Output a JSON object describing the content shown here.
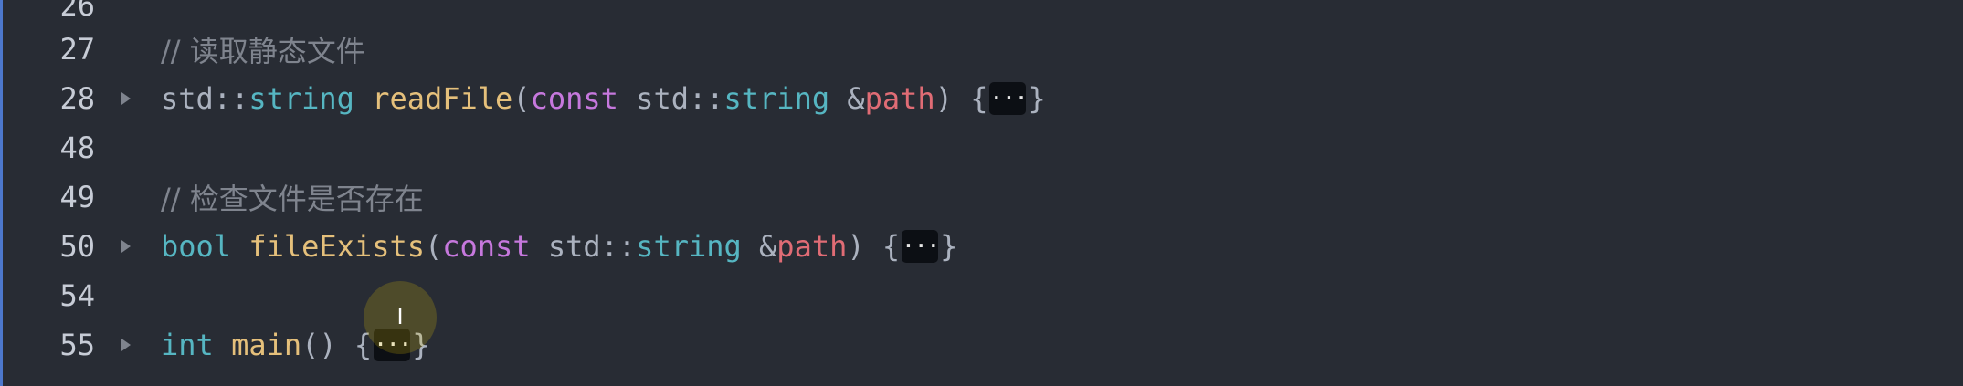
{
  "editor": {
    "lines": [
      {
        "number": "26"
      },
      {
        "number": "27",
        "comment": "// 读取静态文件"
      },
      {
        "number": "28",
        "tokens": {
          "ns": "std::",
          "type": "string",
          "fn": "readFile",
          "paren_open": "(",
          "kw": "const",
          "ns2": "std::",
          "type2": "string",
          "amp": "&",
          "param": "path",
          "paren_close": ")",
          "brace_open": "{",
          "ellipsis": "···",
          "brace_close": "}"
        }
      },
      {
        "number": "48"
      },
      {
        "number": "49",
        "comment": "// 检查文件是否存在"
      },
      {
        "number": "50",
        "tokens": {
          "ret": "bool",
          "fn": "fileExists",
          "paren_open": "(",
          "kw": "const",
          "ns2": "std::",
          "type2": "string",
          "amp": "&",
          "param": "path",
          "paren_close": ")",
          "brace_open": "{",
          "ellipsis": "···",
          "brace_close": "}"
        }
      },
      {
        "number": "54"
      },
      {
        "number": "55",
        "tokens": {
          "ret": "int",
          "fn": "main",
          "parens": "()",
          "brace_open": "{",
          "ellipsis": "···",
          "brace_close": "}"
        }
      }
    ],
    "cursor_icon": "text-cursor-icon"
  },
  "colors": {
    "background": "#282c34",
    "comment": "#7f848e",
    "type": "#56b6c2",
    "function": "#e5c07b",
    "keyword": "#c678dd",
    "parameter": "#e06c75"
  }
}
